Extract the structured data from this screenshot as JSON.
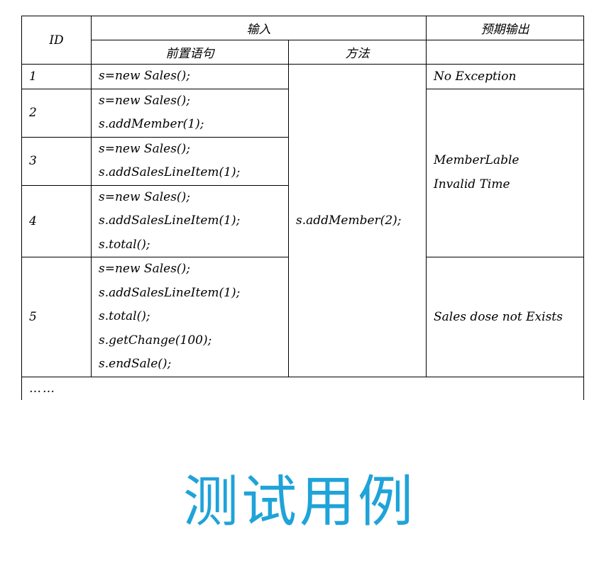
{
  "header": {
    "id": "ID",
    "input": "输入",
    "expected": "预期输出",
    "precondition": "前置语句",
    "method": "方法"
  },
  "rows": [
    {
      "id": "1",
      "pre": [
        "s=new Sales();"
      ]
    },
    {
      "id": "2",
      "pre": [
        "s=new Sales();",
        "s.addMember(1);"
      ]
    },
    {
      "id": "3",
      "pre": [
        "s=new Sales();",
        "s.addSalesLineItem(1);"
      ]
    },
    {
      "id": "4",
      "pre": [
        "s=new Sales();",
        "s.addSalesLineItem(1);",
        "s.total();"
      ]
    },
    {
      "id": "5",
      "pre": [
        "s=new Sales();",
        "s.addSalesLineItem(1);",
        "s.total();",
        "s.getChange(100);",
        "s.endSale();"
      ]
    }
  ],
  "method": "s.addMember(2);",
  "expected": {
    "row1": "No Exception",
    "rows2to4": [
      "MemberLable",
      "Invalid Time"
    ],
    "row5": "Sales dose not Exists"
  },
  "ellipsis": "……",
  "caption": "测试用例",
  "colors": {
    "caption": "#1fa3d9",
    "border": "#000000"
  }
}
